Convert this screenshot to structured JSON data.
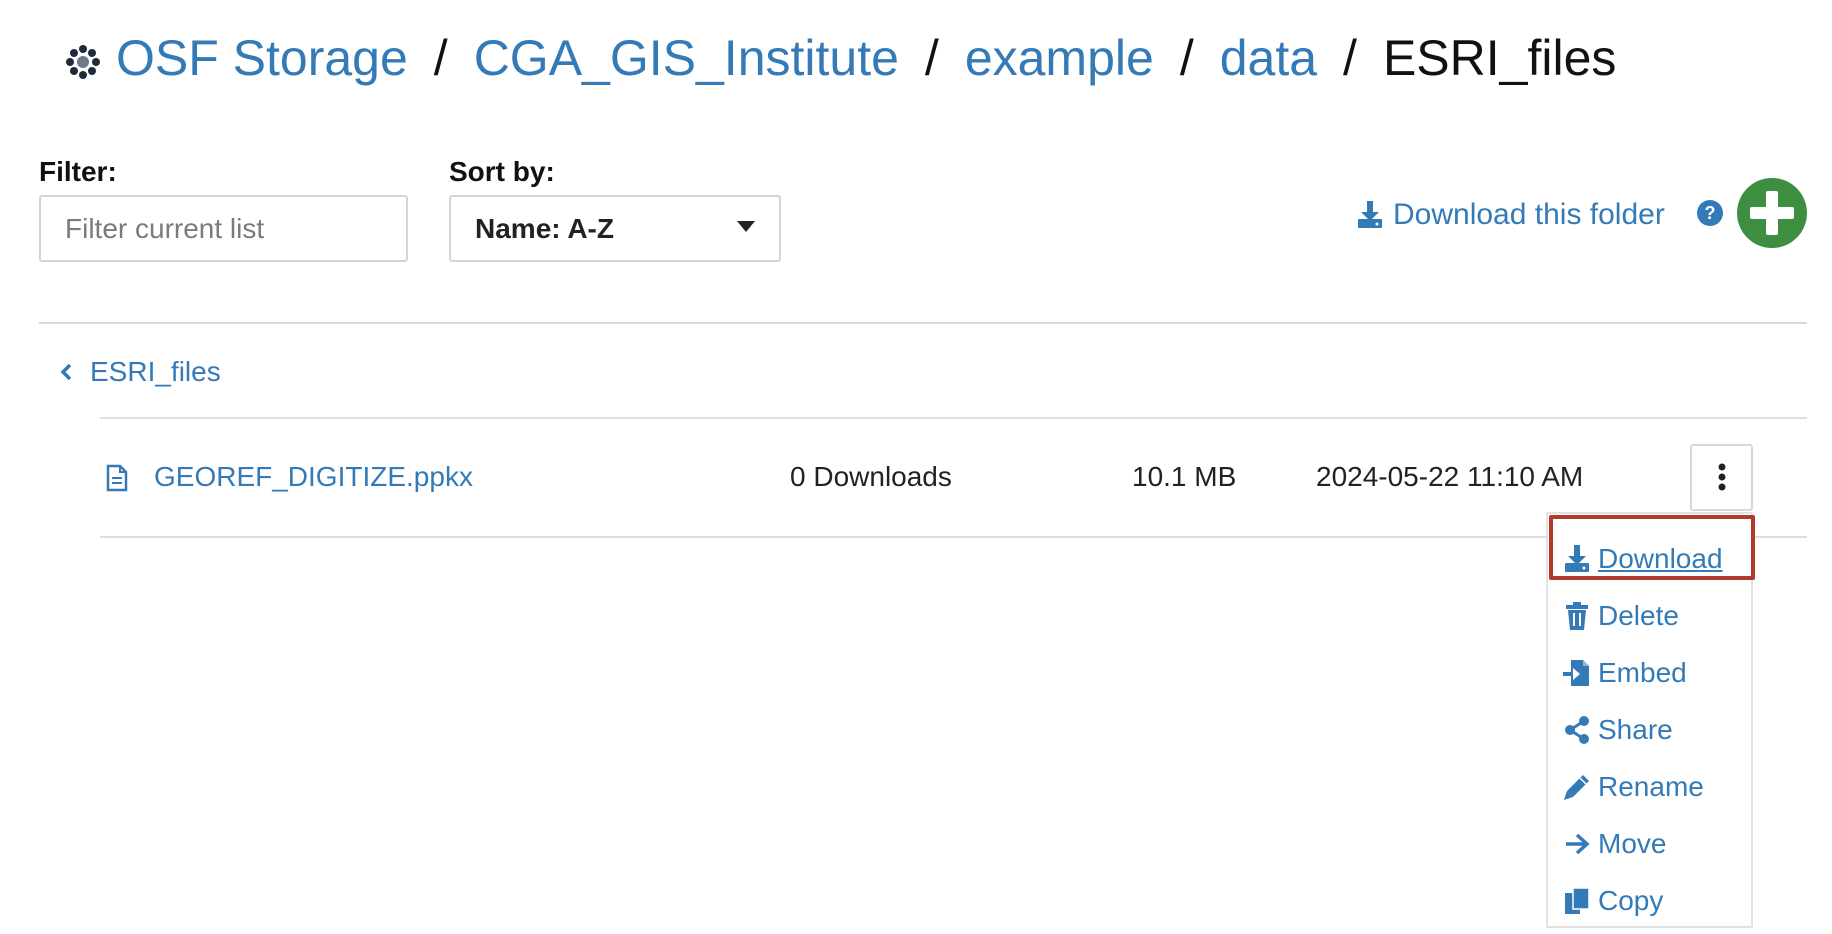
{
  "breadcrumb": {
    "items": [
      "OSF Storage",
      "CGA_GIS_Institute",
      "example",
      "data"
    ],
    "current": "ESRI_files",
    "separator": "/"
  },
  "toolbar": {
    "filter_label": "Filter:",
    "filter_placeholder": "Filter current list",
    "filter_value": "",
    "sort_label": "Sort by:",
    "sort_value": "Name: A-Z",
    "download_folder_label": "Download this folder"
  },
  "folder": {
    "back_label": "ESRI_files"
  },
  "files": [
    {
      "name": "GEOREF_DIGITIZE.ppkx",
      "downloads": "0 Downloads",
      "size": "10.1 MB",
      "modified": "2024-05-22 11:10 AM"
    }
  ],
  "menu": {
    "items": [
      {
        "label": "Download",
        "icon": "download-icon"
      },
      {
        "label": "Delete",
        "icon": "trash-icon"
      },
      {
        "label": "Embed",
        "icon": "embed-icon"
      },
      {
        "label": "Share",
        "icon": "share-icon"
      },
      {
        "label": "Rename",
        "icon": "pencil-icon"
      },
      {
        "label": "Move",
        "icon": "arrow-right-icon"
      },
      {
        "label": "Copy",
        "icon": "copy-icon"
      }
    ],
    "highlighted_item": "Download"
  },
  "colors": {
    "link": "#337ab7",
    "add_button": "#3e8e41",
    "highlight_border": "#b03a2e",
    "text": "#222222"
  }
}
